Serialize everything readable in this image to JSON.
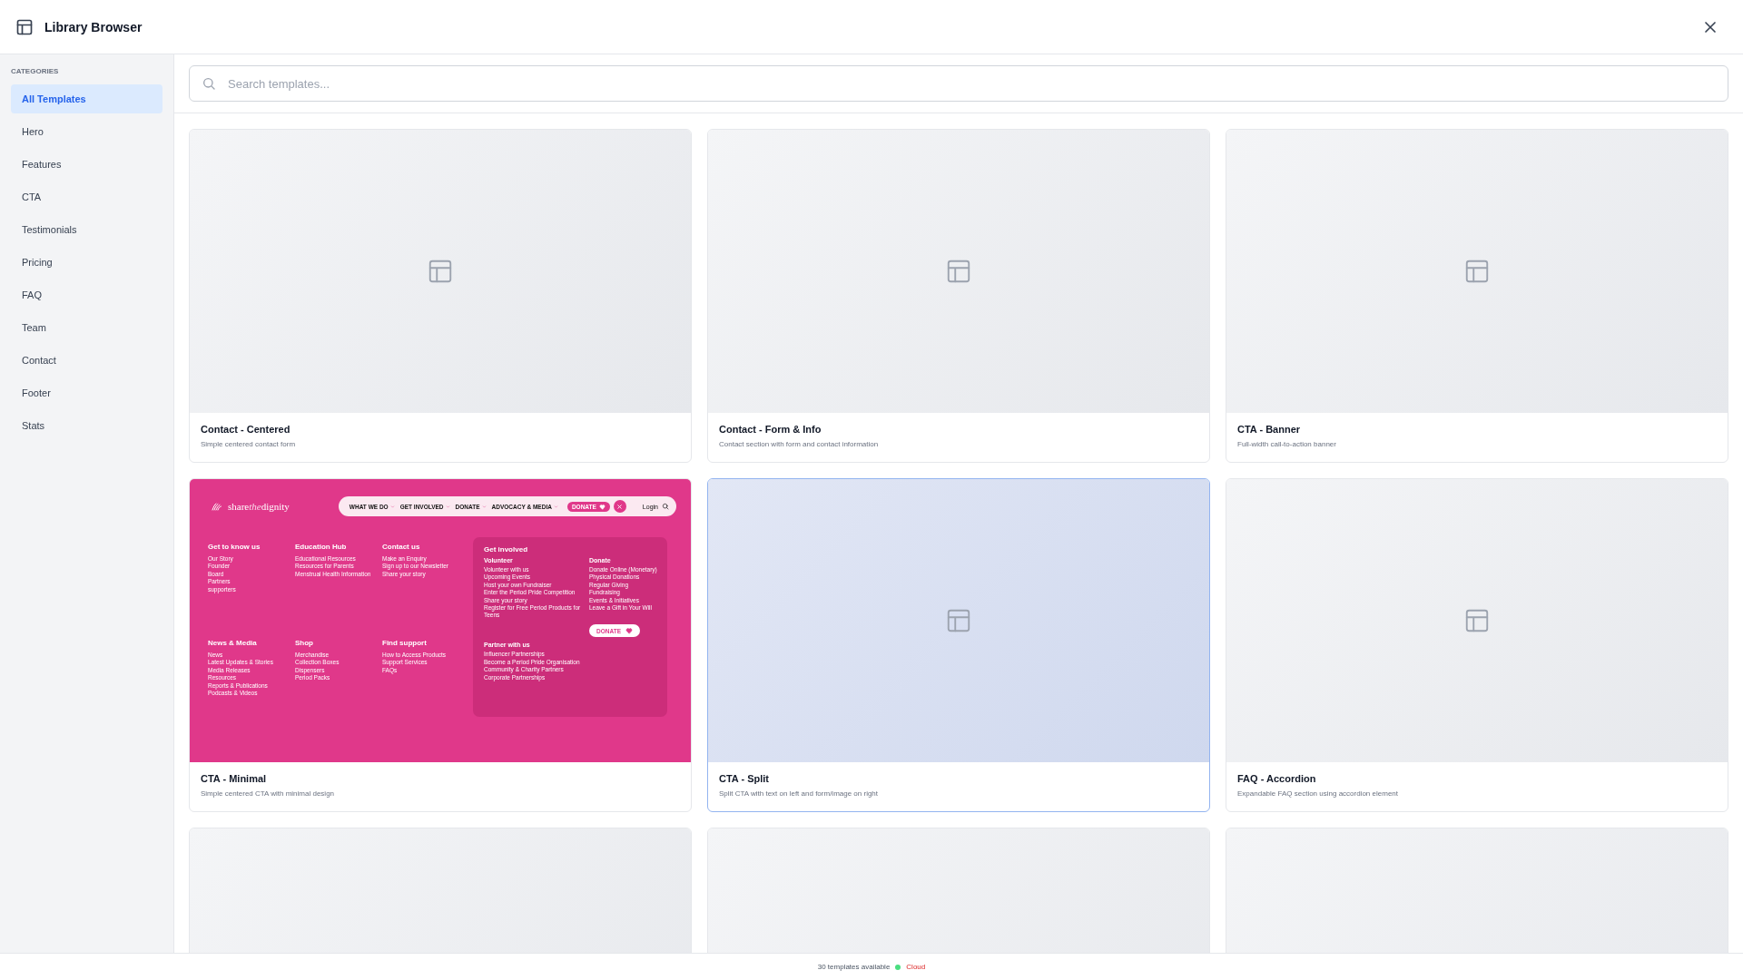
{
  "window": {
    "title": "Library Browser"
  },
  "sidebar": {
    "heading": "CATEGORIES",
    "items": [
      {
        "label": "All Templates",
        "selected": true
      },
      {
        "label": "Hero",
        "selected": false
      },
      {
        "label": "Features",
        "selected": false
      },
      {
        "label": "CTA",
        "selected": false
      },
      {
        "label": "Testimonials",
        "selected": false
      },
      {
        "label": "Pricing",
        "selected": false
      },
      {
        "label": "FAQ",
        "selected": false
      },
      {
        "label": "Team",
        "selected": false
      },
      {
        "label": "Contact",
        "selected": false
      },
      {
        "label": "Footer",
        "selected": false
      },
      {
        "label": "Stats",
        "selected": false
      }
    ]
  },
  "search": {
    "placeholder": "Search templates..."
  },
  "cards": [
    {
      "title": "Contact - Centered",
      "description": "Simple centered contact form",
      "selected": false,
      "thumbnail": {
        "kind": "placeholder"
      }
    },
    {
      "title": "Contact - Form & Info",
      "description": "Contact section with form and contact information",
      "selected": false,
      "thumbnail": {
        "kind": "placeholder"
      }
    },
    {
      "title": "CTA - Banner",
      "description": "Full-width call-to-action banner",
      "selected": false,
      "thumbnail": {
        "kind": "placeholder"
      }
    },
    {
      "title": "CTA - Minimal",
      "description": "Simple centered CTA with minimal design",
      "selected": false,
      "thumbnail": {
        "kind": "footer",
        "logo": [
          {
            "text": "share",
            "italic": false
          },
          {
            "text": "the",
            "italic": true
          },
          {
            "text": "dignity",
            "italic": false
          }
        ],
        "nav": [
          "WHAT WE DO",
          "GET INVOLVED",
          "DONATE",
          "ADVOCACY & MEDIA"
        ],
        "donate_button": "DONATE",
        "login": "Login",
        "columns": [
          {
            "heading": "Get to know us",
            "links": [
              "Our Story",
              "Founder",
              "Board",
              "Partners",
              "supporters"
            ]
          },
          {
            "heading": "Education Hub",
            "links": [
              "Educational Resources",
              "Resources for Parents",
              "Menstrual Health Information"
            ]
          },
          {
            "heading": "Contact us",
            "links": [
              "Make an Enquiry",
              "Sign up to our Newsletter",
              "Share your story"
            ]
          },
          {
            "heading": "News & Media",
            "links": [
              "News",
              "Latest Updates & Stories",
              "Media Releases",
              "Resources",
              "Reports & Publications",
              "Podcasts & Videos"
            ]
          },
          {
            "heading": "Shop",
            "links": [
              "Merchandise",
              "Collection Boxes",
              "Dispensers",
              "Period Packs"
            ]
          },
          {
            "heading": "Find support",
            "links": [
              "How to Access Products",
              "Support Services",
              "FAQs"
            ]
          }
        ],
        "panel": {
          "heading": "Get involved",
          "groups": [
            {
              "heading": "Volunteer",
              "links": [
                "Volunteer with us",
                "Upcoming Events",
                "Host your own Fundraiser",
                "Enter the Period Pride Competition",
                "Share your story",
                "Register for Free Period Products for Teens"
              ]
            },
            {
              "heading": "Donate",
              "links": [
                "Donate Online (Monetary)",
                "Physical Donations",
                "Regular Giving",
                "Fundraising",
                "Events & Initiatives",
                "Leave a Gift in Your Will"
              ]
            },
            {
              "heading": "Partner with us",
              "links": [
                "Influencer Partnerships",
                "Become a Period Pride Organisation",
                "Community & Charity Partners",
                "Corporate Partnerships"
              ]
            }
          ],
          "button": "DONATE"
        }
      }
    },
    {
      "title": "CTA - Split",
      "description": "Split CTA with text on left and form/image on right",
      "selected": true,
      "thumbnail": {
        "kind": "placeholder"
      }
    },
    {
      "title": "FAQ - Accordion",
      "description": "Expandable FAQ section using accordion element",
      "selected": false,
      "thumbnail": {
        "kind": "placeholder"
      }
    },
    {
      "selected": false,
      "thumbnail": {
        "kind": "blank"
      }
    },
    {
      "selected": false,
      "thumbnail": {
        "kind": "blank"
      }
    },
    {
      "selected": false,
      "thumbnail": {
        "kind": "blank"
      }
    }
  ],
  "status_bar": {
    "count": "30 templates available",
    "source": "Cloud"
  }
}
